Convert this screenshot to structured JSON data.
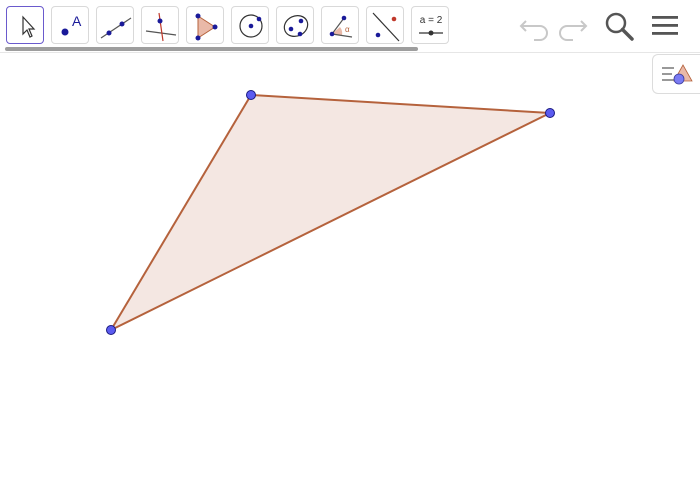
{
  "toolbar": {
    "tools": [
      {
        "name": "move-tool",
        "icon": "cursor-arrow-icon",
        "active": true
      },
      {
        "name": "point-tool",
        "icon": "point-icon",
        "label": "A"
      },
      {
        "name": "line-tool",
        "icon": "line-through-points-icon"
      },
      {
        "name": "perpendicular-line-tool",
        "icon": "perpendicular-line-icon"
      },
      {
        "name": "polygon-tool",
        "icon": "polygon-icon"
      },
      {
        "name": "circle-tool",
        "icon": "circle-center-point-icon"
      },
      {
        "name": "conic-tool",
        "icon": "ellipse-icon"
      },
      {
        "name": "angle-tool",
        "icon": "angle-icon",
        "label": "α"
      },
      {
        "name": "reflect-tool",
        "icon": "reflect-about-line-icon"
      },
      {
        "name": "slider-tool",
        "icon": "slider-icon",
        "label": "a = 2"
      }
    ],
    "actions": [
      {
        "name": "undo-button",
        "icon": "undo-icon"
      },
      {
        "name": "redo-button",
        "icon": "redo-icon"
      },
      {
        "name": "search-button",
        "icon": "search-icon"
      },
      {
        "name": "menu-button",
        "icon": "hamburger-menu-icon"
      }
    ]
  },
  "style_bar": {
    "icon": "style-bar-toggle-icon"
  },
  "colors": {
    "point_fill": "#5b5bf0",
    "point_stroke": "#1a1a80",
    "polygon_stroke": "#b5623c",
    "polygon_fill": "#f4e7e2",
    "active_tool_border": "#6a5acd"
  }
}
